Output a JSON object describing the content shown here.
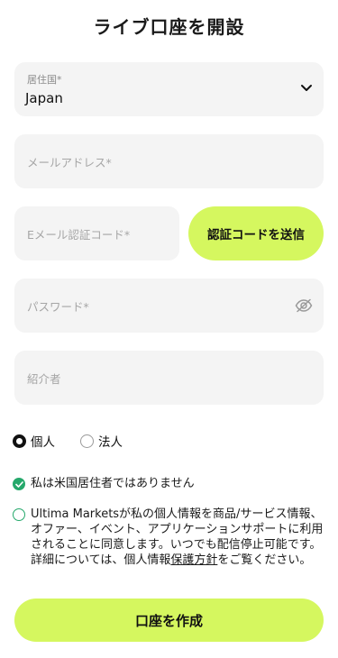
{
  "page": {
    "title": "ライブ口座を開設"
  },
  "residence": {
    "label": "居住国*",
    "value": "Japan"
  },
  "email": {
    "placeholder": "メールアドレス*"
  },
  "email_code": {
    "placeholder": "Eメール認証コード*",
    "send_label": "認証コードを送信"
  },
  "password": {
    "placeholder": "パスワード*"
  },
  "referrer": {
    "placeholder": "紹介者"
  },
  "account_type": {
    "individual": "個人",
    "corporate": "法人",
    "selected": "個人"
  },
  "us_resident": {
    "label": "私は米国居住者ではありません",
    "checked": true
  },
  "consent": {
    "text_before": "Ultima Marketsが私の個人情報を商品/サービス情報、オファー、イベント、アプリケーションサポートに利用されることに同意します。いつでも配信停止可能です。詳細については、個人情報",
    "link": "保護方針",
    "text_after": "をご覧ください。",
    "checked": false
  },
  "submit": {
    "label": "口座を作成"
  },
  "colors": {
    "accent": "#d5f75f",
    "check": "#25a86b",
    "field_bg": "#f4f4f4"
  }
}
